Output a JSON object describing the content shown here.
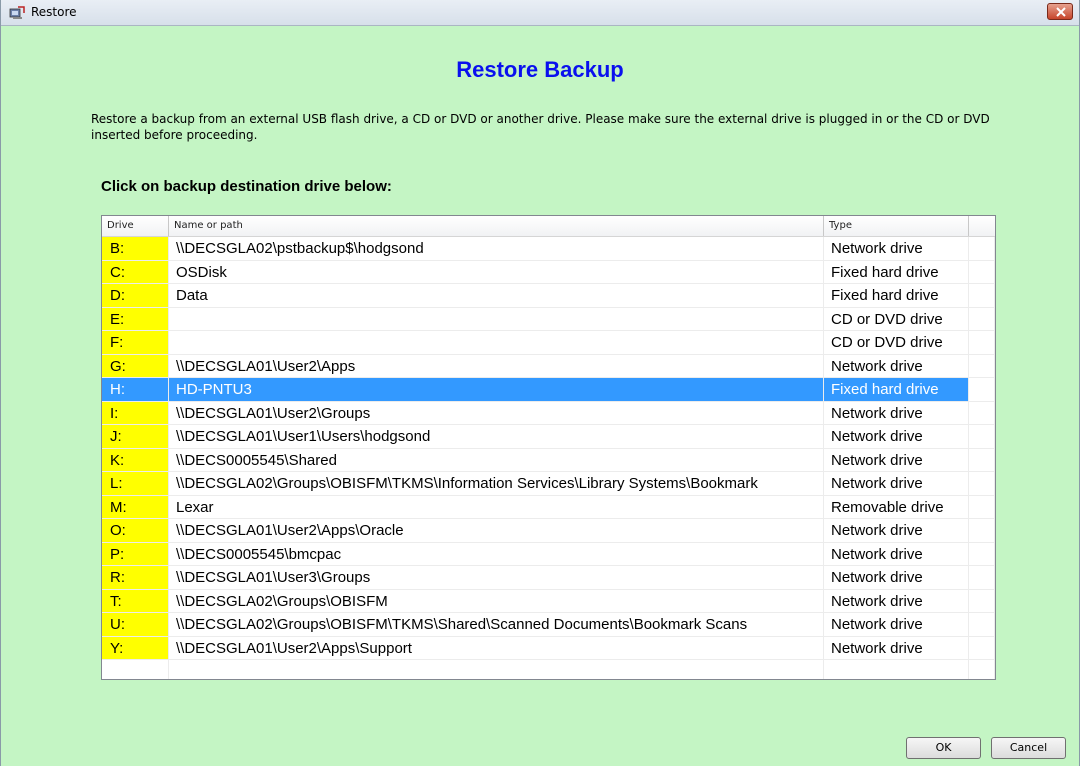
{
  "window": {
    "title": "Restore"
  },
  "heading": "Restore Backup",
  "intro_text": "Restore a backup from an external USB flash drive, a CD or DVD or another drive.  Please make sure the external drive is plugged in or the CD or DVD inserted before proceeding.",
  "instruction": "Click on backup destination drive below:",
  "table": {
    "columns": [
      "Drive",
      "Name or path",
      "Type"
    ],
    "selected_index": 6,
    "rows": [
      {
        "drive": "B:",
        "name": "\\\\DECSGLA02\\pstbackup$\\hodgsond",
        "type": "Network drive"
      },
      {
        "drive": "C:",
        "name": "OSDisk",
        "type": "Fixed hard drive"
      },
      {
        "drive": "D:",
        "name": "Data",
        "type": "Fixed hard drive"
      },
      {
        "drive": "E:",
        "name": "",
        "type": "CD or DVD drive"
      },
      {
        "drive": "F:",
        "name": "",
        "type": "CD or DVD drive"
      },
      {
        "drive": "G:",
        "name": "\\\\DECSGLA01\\User2\\Apps",
        "type": "Network drive"
      },
      {
        "drive": "H:",
        "name": "HD-PNTU3",
        "type": "Fixed hard drive"
      },
      {
        "drive": "I:",
        "name": "\\\\DECSGLA01\\User2\\Groups",
        "type": "Network drive"
      },
      {
        "drive": "J:",
        "name": "\\\\DECSGLA01\\User1\\Users\\hodgsond",
        "type": "Network drive"
      },
      {
        "drive": "K:",
        "name": "\\\\DECS0005545\\Shared",
        "type": "Network drive"
      },
      {
        "drive": "L:",
        "name": "\\\\DECSGLA02\\Groups\\OBISFM\\TKMS\\Information Services\\Library Systems\\Bookmark",
        "type": "Network drive"
      },
      {
        "drive": "M:",
        "name": "Lexar",
        "type": "Removable drive"
      },
      {
        "drive": "O:",
        "name": "\\\\DECSGLA01\\User2\\Apps\\Oracle",
        "type": "Network drive"
      },
      {
        "drive": "P:",
        "name": "\\\\DECS0005545\\bmcpac",
        "type": "Network drive"
      },
      {
        "drive": "R:",
        "name": "\\\\DECSGLA01\\User3\\Groups",
        "type": "Network drive"
      },
      {
        "drive": "T:",
        "name": "\\\\DECSGLA02\\Groups\\OBISFM",
        "type": "Network drive"
      },
      {
        "drive": "U:",
        "name": "\\\\DECSGLA02\\Groups\\OBISFM\\TKMS\\Shared\\Scanned Documents\\Bookmark Scans",
        "type": "Network drive"
      },
      {
        "drive": "Y:",
        "name": "\\\\DECSGLA01\\User2\\Apps\\Support",
        "type": "Network drive"
      },
      {
        "drive": "",
        "name": "",
        "type": ""
      }
    ]
  },
  "buttons": {
    "ok": "OK",
    "cancel": "Cancel"
  },
  "icons": {
    "app": "restore-app-icon",
    "close": "close-icon"
  },
  "colors": {
    "background": "#c4f5c4",
    "heading": "#0a10ee",
    "drive_highlight": "#ffff00",
    "selection": "#3399ff",
    "close_button": "#c7452a"
  }
}
